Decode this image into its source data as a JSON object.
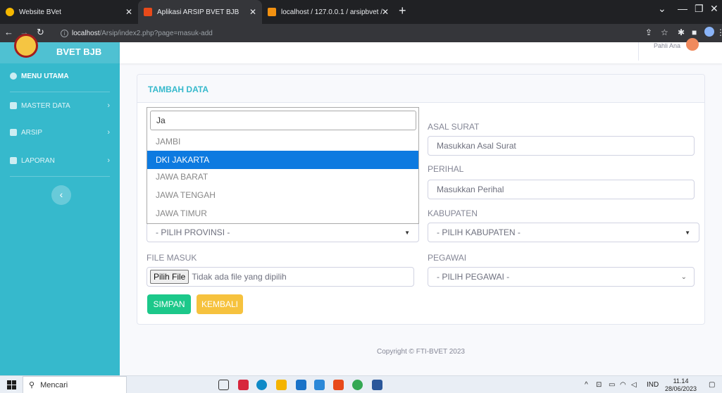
{
  "browser": {
    "tabs": [
      {
        "title": "Website BVet"
      },
      {
        "title": "Aplikasi ARSIP BVET BJB"
      },
      {
        "title": "localhost / 127.0.0.1 / arsipbvet /"
      }
    ],
    "new_tab": "+",
    "url_host": "localhost",
    "url_path": "/Arsip/index2.php?page=masuk-add"
  },
  "sidebar": {
    "brand": "BVET BJB",
    "items": [
      {
        "label": "MENU UTAMA"
      },
      {
        "label": "MASTER DATA"
      },
      {
        "label": "ARSIP"
      },
      {
        "label": "LAPORAN"
      }
    ],
    "toggle": "‹"
  },
  "topbar": {
    "user_name": "Pahli Ana"
  },
  "form": {
    "title": "TAMBAH DATA",
    "provinsi_search": "Ja",
    "provinsi_options": [
      "JAMBI",
      "DKI JAKARTA",
      "JAWA BARAT",
      "JAWA TENGAH",
      "JAWA TIMUR"
    ],
    "provinsi_selected_index": 1,
    "provinsi_select": "- PILIH PROVINSI -",
    "asal_surat_label": "ASAL SURAT",
    "asal_surat_placeholder": "Masukkan Asal Surat",
    "perihal_label": "PERIHAL",
    "perihal_placeholder": "Masukkan Perihal",
    "kabupaten_label": "KABUPATEN",
    "kabupaten_select": "- PILIH KABUPATEN -",
    "file_label": "FILE MASUK",
    "file_button": "Pilih File",
    "file_status": "Tidak ada file yang dipilih",
    "pegawai_label": "PEGAWAI",
    "pegawai_select": "- PILIH PEGAWAI -",
    "save_button": "SIMPAN",
    "back_button": "KEMBALI"
  },
  "footer": {
    "copyright": "Copyright © FTI-BVET 2023"
  },
  "taskbar": {
    "search": "Mencari",
    "lang": "IND",
    "time": "11.14",
    "date": "28/06/2023"
  }
}
